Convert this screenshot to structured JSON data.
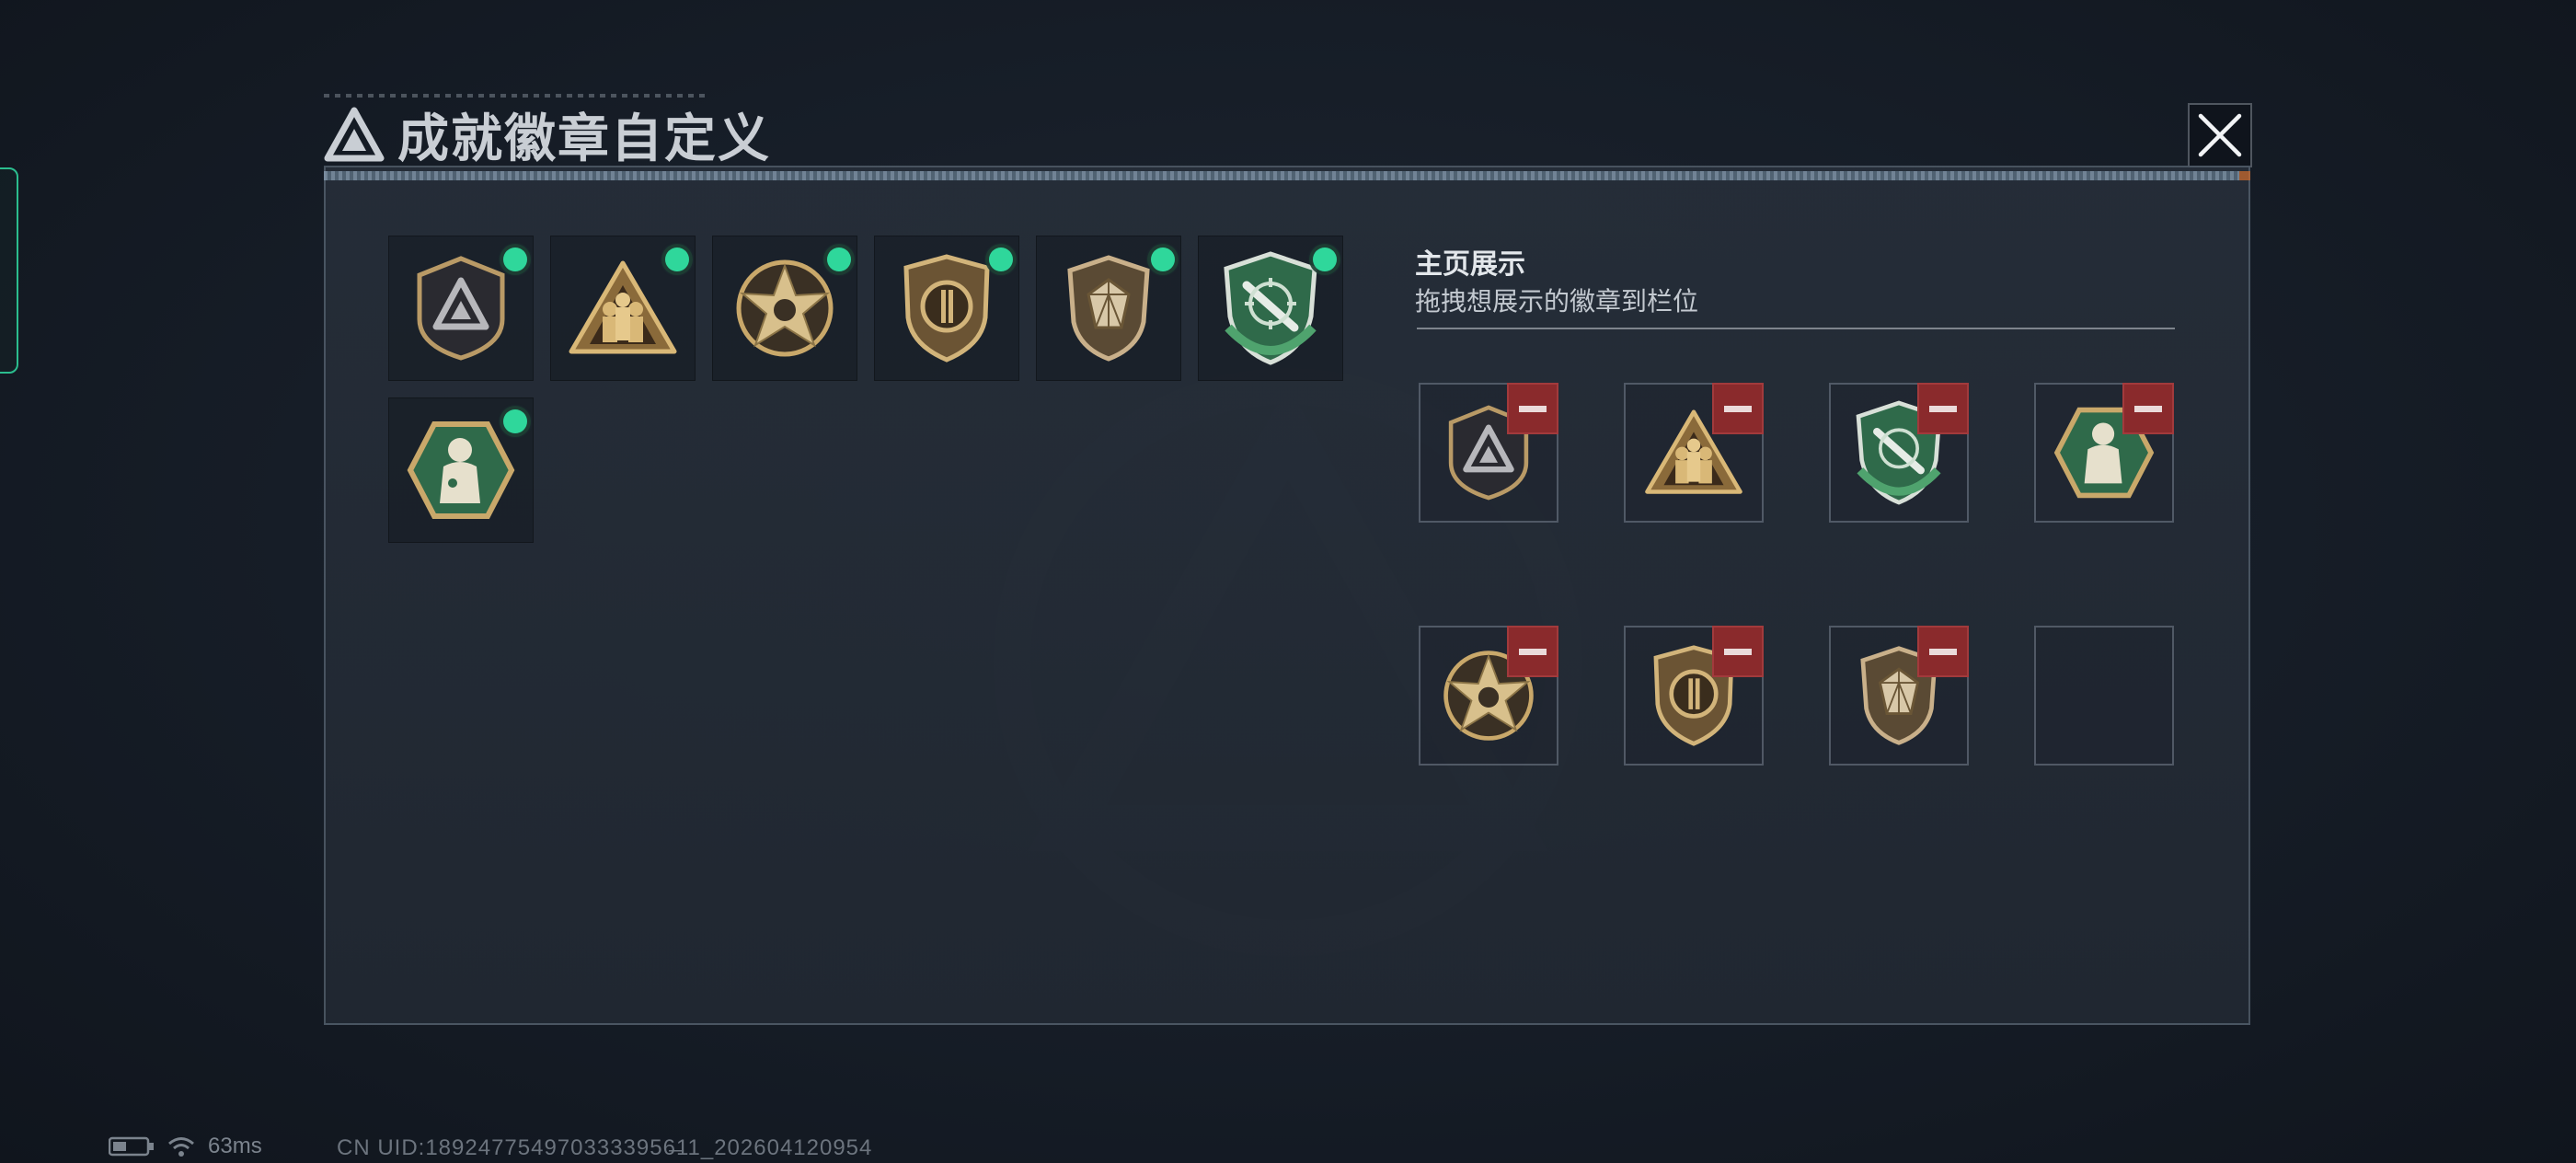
{
  "dialog": {
    "title": "成就徽章自定义",
    "close_icon": "close-icon"
  },
  "inventory": {
    "badges": [
      {
        "icon": "triangle-shield-badge",
        "equipped": true
      },
      {
        "icon": "soldiers-triangle-badge",
        "equipped": true
      },
      {
        "icon": "star-badge",
        "equipped": true
      },
      {
        "icon": "crest-shield-badge",
        "equipped": true
      },
      {
        "icon": "gem-shield-badge",
        "equipped": true
      },
      {
        "icon": "green-knife-badge",
        "equipped": true
      },
      {
        "icon": "green-hexagon-soldier-badge",
        "equipped": true
      }
    ]
  },
  "showcase": {
    "title": "主页展示",
    "subtitle": "拖拽想展示的徽章到栏位",
    "slots": [
      {
        "icon": "triangle-shield-badge",
        "filled": true
      },
      {
        "icon": "soldiers-triangle-badge",
        "filled": true
      },
      {
        "icon": "green-knife-badge",
        "filled": true
      },
      {
        "icon": "green-hexagon-soldier-badge",
        "filled": true
      },
      {
        "icon": "star-badge",
        "filled": true
      },
      {
        "icon": "crest-shield-badge",
        "filled": true
      },
      {
        "icon": "gem-shield-badge",
        "filled": true
      },
      {
        "icon": "",
        "filled": false
      }
    ]
  },
  "status_bar": {
    "ping": "63ms",
    "uid": "CN UID:1892477549703333956̶11_202604120954"
  },
  "colors": {
    "equipped_dot": "#2fd79b",
    "remove_button": "#8a2a2c",
    "badge_gold": "#c9a86a",
    "badge_green": "#2f6a4a"
  }
}
